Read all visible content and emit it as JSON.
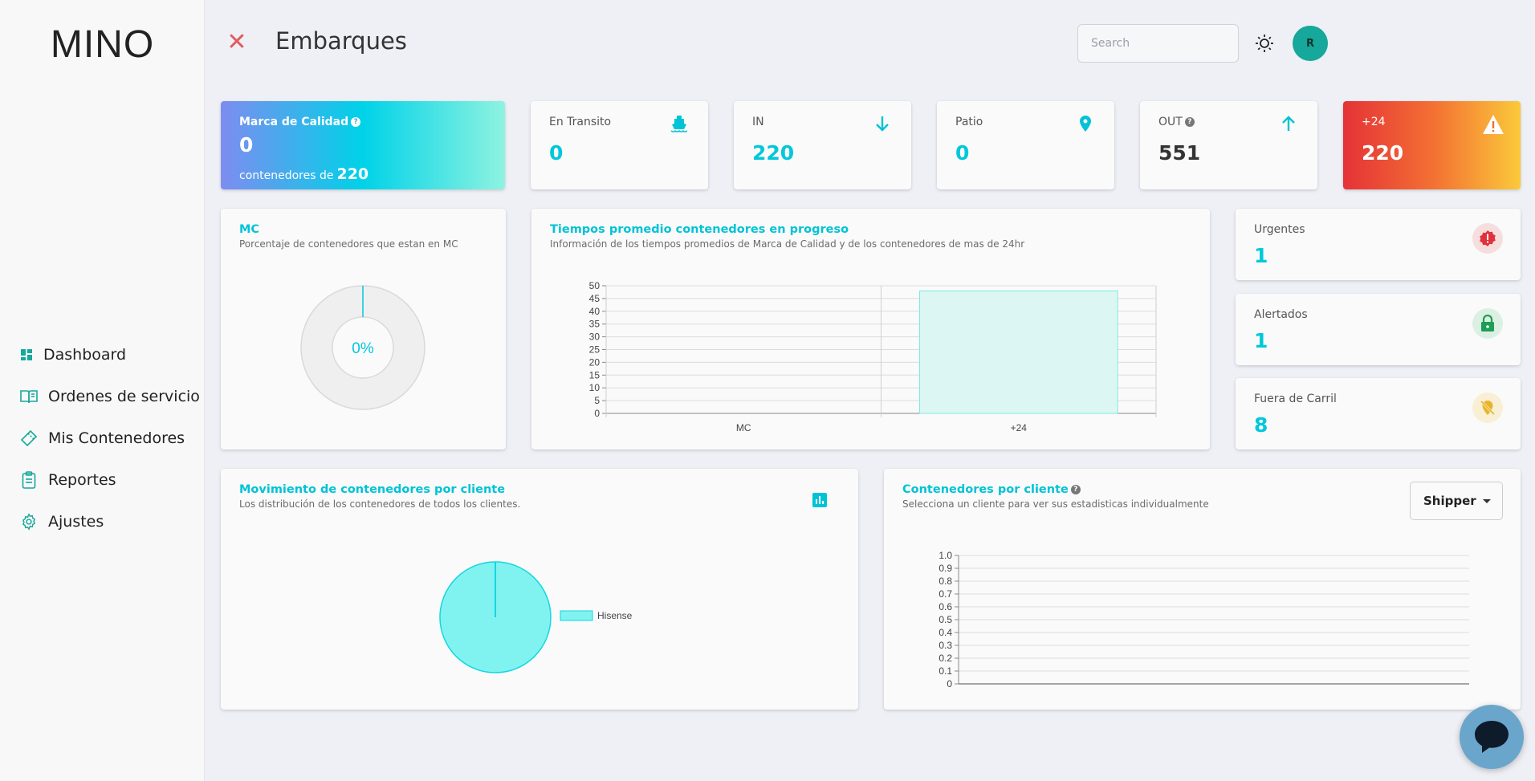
{
  "app": {
    "logo": "MINO",
    "page_title": "Embarques"
  },
  "sidebar": {
    "items": [
      {
        "label": "Dashboard",
        "icon": "dashboard-icon"
      },
      {
        "label": "Ordenes de servicio",
        "icon": "book-icon"
      },
      {
        "label": "Mis Contenedores",
        "icon": "ticket-icon"
      },
      {
        "label": "Reportes",
        "icon": "clipboard-icon"
      },
      {
        "label": "Ajustes",
        "icon": "gear-icon"
      }
    ]
  },
  "header": {
    "search_placeholder": "Search",
    "avatar_initial": "R"
  },
  "stats": {
    "mc": {
      "label": "Marca de Calidad",
      "value": "0",
      "sub_label": "contenedores de",
      "sub_value": "220"
    },
    "transit": {
      "label": "En Transito",
      "value": "0",
      "icon": "ship-icon"
    },
    "in": {
      "label": "IN",
      "value": "220",
      "icon": "arrow-down-icon"
    },
    "patio": {
      "label": "Patio",
      "value": "0",
      "icon": "location-pin-icon"
    },
    "out": {
      "label": "OUT",
      "value": "551",
      "icon": "arrow-up-icon"
    },
    "plus24": {
      "label": "+24",
      "value": "220",
      "icon": "warning-icon"
    }
  },
  "mc_panel": {
    "title": "MC",
    "subtitle": "Porcentaje de contenedores que estan en MC",
    "percent_label": "0%",
    "percent": 0
  },
  "times_panel": {
    "title": "Tiempos promedio contenedores en progreso",
    "subtitle": "Información de los tiempos promedios de Marca de Calidad y de los contenedores de mas de 24hr"
  },
  "side_cards": [
    {
      "label": "Urgentes",
      "value": "1",
      "icon": "alert-badge-icon",
      "color": "#e0323d"
    },
    {
      "label": "Alertados",
      "value": "1",
      "icon": "lock-icon",
      "color": "#1e9e55"
    },
    {
      "label": "Fuera de Carril",
      "value": "8",
      "icon": "location-off-icon",
      "color": "#e8b52a"
    }
  ],
  "movement_panel": {
    "title": "Movimiento de contenedores por cliente",
    "subtitle": "Los distribución de los contenedores de todos los clientes."
  },
  "client_panel": {
    "title": "Contenedores por cliente",
    "subtitle": "Selecciona un cliente para ver sus estadisticas individualmente",
    "dropdown_value": "Shipper"
  },
  "colors": {
    "accent": "#00c8da",
    "teal": "#16a89a",
    "danger": "#e05b5b"
  },
  "chart_data": [
    {
      "type": "bar",
      "categories": [
        "MC",
        "+24"
      ],
      "values": [
        0,
        48
      ],
      "ylim": [
        0,
        50
      ],
      "yticks": [
        0,
        5,
        10,
        15,
        20,
        25,
        30,
        35,
        40,
        45,
        50
      ],
      "grid": true
    },
    {
      "type": "pie",
      "labels": [
        "Hisense"
      ],
      "values": [
        1
      ],
      "legend": "right"
    },
    {
      "type": "line",
      "ylim": [
        0,
        1.0
      ],
      "yticks": [
        "0",
        "0.1",
        "0.2",
        "0.3",
        "0.4",
        "0.5",
        "0.6",
        "0.7",
        "0.8",
        "0.9",
        "1.0"
      ],
      "series": [],
      "grid": true
    }
  ]
}
